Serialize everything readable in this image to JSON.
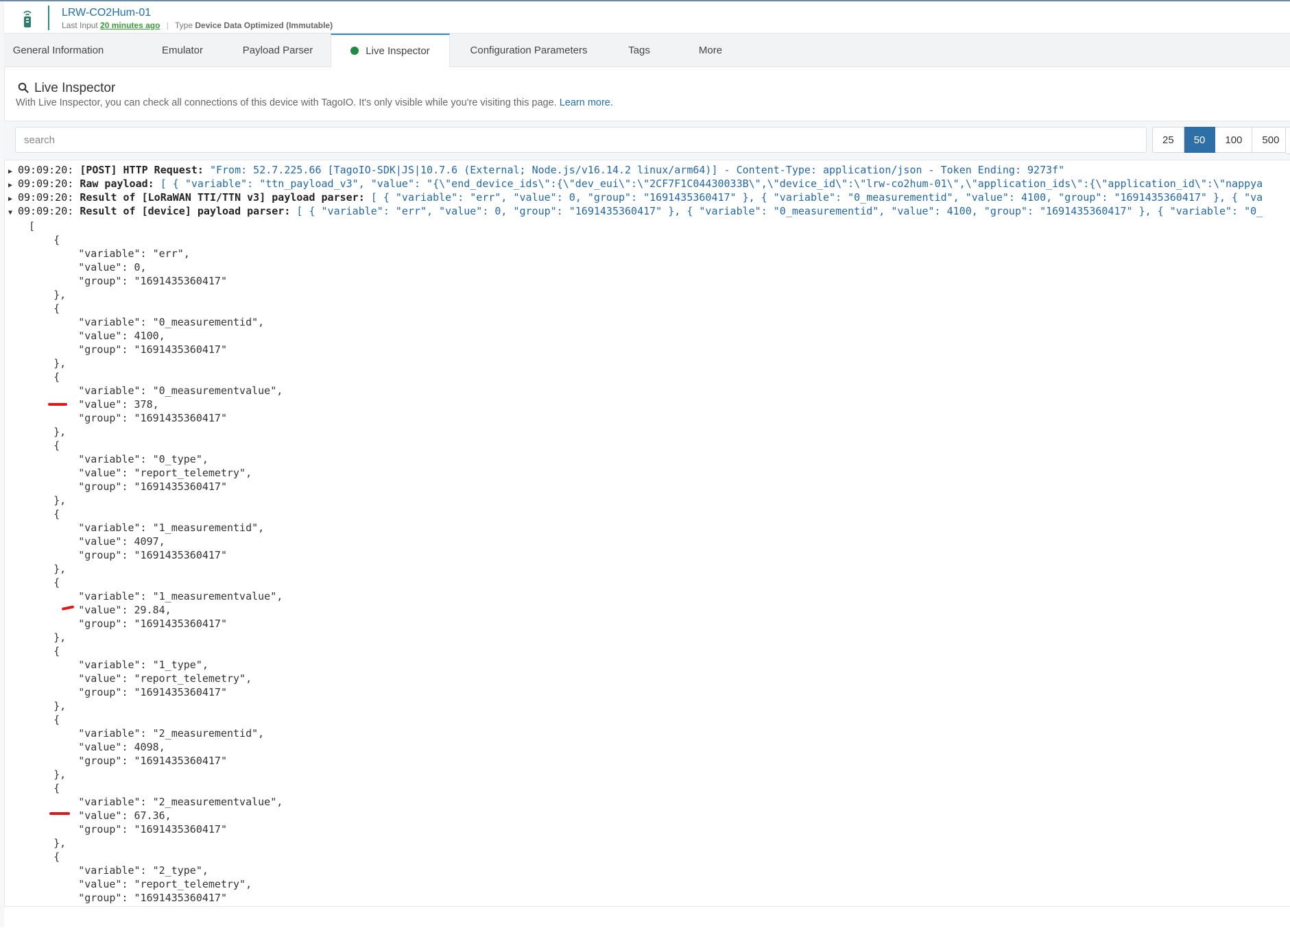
{
  "device": {
    "name": "LRW-CO2Hum-01",
    "last_input_label": "Last Input",
    "last_input_value": "20 minutes ago",
    "type_label": "Type",
    "type_value": "Device Data Optimized (Immutable)"
  },
  "tabs": [
    {
      "label": "General Information"
    },
    {
      "label": "Emulator"
    },
    {
      "label": "Payload Parser"
    },
    {
      "label": "Live Inspector",
      "active": true,
      "status_color": "#1f8a45"
    },
    {
      "label": "Configuration Parameters"
    },
    {
      "label": "Tags"
    },
    {
      "label": "More"
    }
  ],
  "inspector": {
    "title": "Live Inspector",
    "description": "With Live Inspector, you can check all connections of this device with TagoIO. It's only visible while you're visiting this page.",
    "learn_more": "Learn more.",
    "search_placeholder": "search",
    "page_sizes": [
      "25",
      "50",
      "100",
      "500"
    ],
    "selected_page_size": "50"
  },
  "log": [
    {
      "time": "09:09:20:",
      "label": "[POST] HTTP Request:",
      "message": "\"From: 52.7.225.66 [TagoIO-SDK|JS|10.7.6 (External; Node.js/v16.14.2 linux/arm64)] - Content-Type: application/json - Token Ending: 9273f\"",
      "expanded": false
    },
    {
      "time": "09:09:20:",
      "label": "Raw payload:",
      "message": "[ { \"variable\": \"ttn_payload_v3\", \"value\": \"{\\\"end_device_ids\\\":{\\\"dev_eui\\\":\\\"2CF7F1C04430033B\\\",\\\"device_id\\\":\\\"lrw-co2hum-01\\\",\\\"application_ids\\\":{\\\"application_id\\\":\\\"nappya",
      "expanded": false
    },
    {
      "time": "09:09:20:",
      "label": "Result of [LoRaWAN TTI/TTN v3] payload parser:",
      "message": "[ { \"variable\": \"err\", \"value\": 0, \"group\": \"1691435360417\" }, { \"variable\": \"0_measurementid\", \"value\": 4100, \"group\": \"1691435360417\" }, { \"va",
      "expanded": false
    },
    {
      "time": "09:09:20:",
      "label": "Result of [device] payload parser:",
      "message": "[ { \"variable\": \"err\", \"value\": 0, \"group\": \"1691435360417\" }, { \"variable\": \"0_measurementid\", \"value\": 4100, \"group\": \"1691435360417\" }, { \"variable\": \"0_",
      "expanded": true
    }
  ],
  "expanded_json": "[\n    {\n        \"variable\": \"err\",\n        \"value\": 0,\n        \"group\": \"1691435360417\"\n    },\n    {\n        \"variable\": \"0_measurementid\",\n        \"value\": 4100,\n        \"group\": \"1691435360417\"\n    },\n    {\n        \"variable\": \"0_measurementvalue\",\n        \"value\": 378,\n        \"group\": \"1691435360417\"\n    },\n    {\n        \"variable\": \"0_type\",\n        \"value\": \"report_telemetry\",\n        \"group\": \"1691435360417\"\n    },\n    {\n        \"variable\": \"1_measurementid\",\n        \"value\": 4097,\n        \"group\": \"1691435360417\"\n    },\n    {\n        \"variable\": \"1_measurementvalue\",\n        \"value\": 29.84,\n        \"group\": \"1691435360417\"\n    },\n    {\n        \"variable\": \"1_type\",\n        \"value\": \"report_telemetry\",\n        \"group\": \"1691435360417\"\n    },\n    {\n        \"variable\": \"2_measurementid\",\n        \"value\": 4098,\n        \"group\": \"1691435360417\"\n    },\n    {\n        \"variable\": \"2_measurementvalue\",\n        \"value\": 67.36,\n        \"group\": \"1691435360417\"\n    },\n    {\n        \"variable\": \"2_type\",\n        \"value\": \"report_telemetry\",\n        \"group\": \"1691435360417\"",
  "colors": {
    "accent": "#2f6fa8",
    "link": "#1f6fa8",
    "log_message": "#2268a8",
    "active_status": "#1f8a45",
    "annotation": "#e0161d"
  }
}
